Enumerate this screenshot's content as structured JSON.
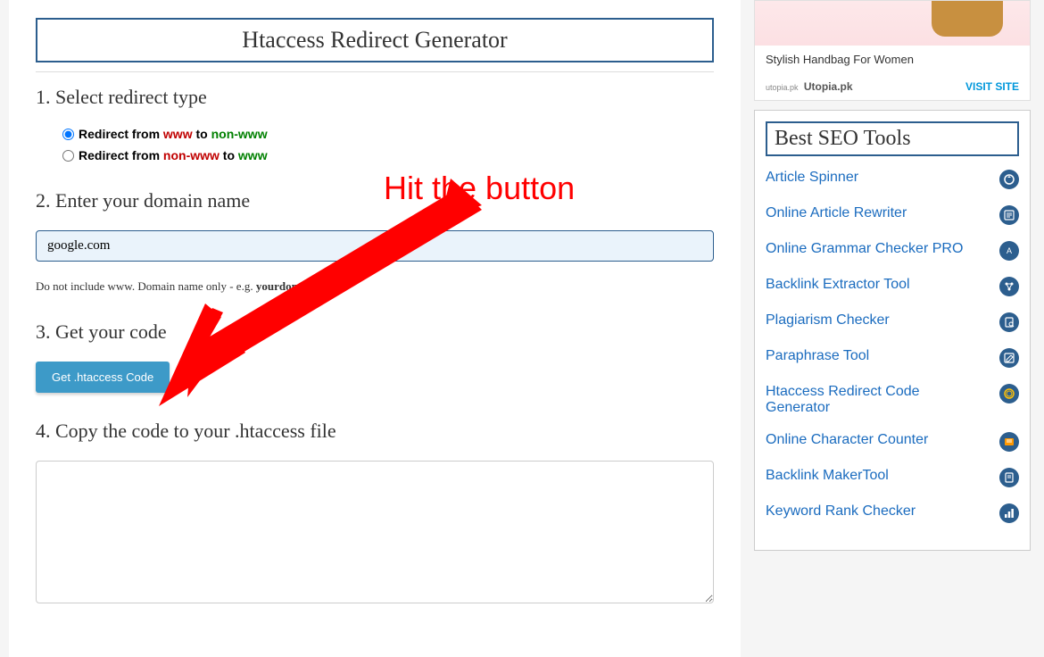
{
  "main": {
    "title": "Htaccess Redirect Generator",
    "steps": {
      "step1": {
        "heading": "1. Select redirect type",
        "option1_prefix": "Redirect from ",
        "option1_from": "www",
        "option1_mid": " to ",
        "option1_to": "non-www",
        "option2_prefix": "Redirect from ",
        "option2_from": "non-www",
        "option2_mid": " to ",
        "option2_to": "www"
      },
      "step2": {
        "heading": "2. Enter your domain name",
        "input_value": "google.com",
        "hint_prefix": "Do not include www. Domain name only - e.g. ",
        "hint_bold": "yourdomain.com"
      },
      "step3": {
        "heading": "3. Get your code",
        "button_label": "Get .htaccess Code"
      },
      "step4": {
        "heading": "4. Copy the code to your .htaccess file"
      }
    }
  },
  "annotation": {
    "text": "Hit the button"
  },
  "sidebar": {
    "ad": {
      "text": "Stylish Handbag For Women",
      "brand": "Utopia.pk",
      "cta": "VISIT SITE"
    },
    "tools_heading": "Best SEO Tools",
    "tools": [
      {
        "label": "Article Spinner",
        "icon": "spinner"
      },
      {
        "label": "Online Article Rewriter",
        "icon": "rewrite"
      },
      {
        "label": "Online Grammar Checker PRO",
        "icon": "grammar"
      },
      {
        "label": "Backlink Extractor Tool",
        "icon": "backlink"
      },
      {
        "label": "Plagiarism Checker",
        "icon": "plagiarism"
      },
      {
        "label": "Paraphrase Tool",
        "icon": "paraphrase"
      },
      {
        "label": "Htaccess Redirect Code Generator",
        "icon": "redirect"
      },
      {
        "label": "Online Character Counter",
        "icon": "counter"
      },
      {
        "label": "Backlink MakerTool",
        "icon": "maker"
      },
      {
        "label": "Keyword Rank Checker",
        "icon": "rank"
      }
    ]
  }
}
